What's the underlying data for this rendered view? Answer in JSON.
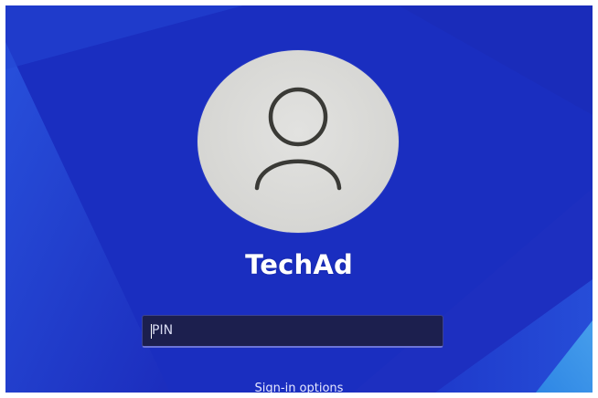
{
  "user": {
    "name": "TechAd",
    "avatar_icon": "person-icon"
  },
  "pin": {
    "placeholder": "PIN",
    "value": ""
  },
  "signin_options": {
    "label": "Sign-in options"
  },
  "colors": {
    "background": "#1a2fc0",
    "avatar": "#d6d6d3",
    "avatar_glyph": "#3a3a36",
    "input_bg": "#1c1f4e",
    "input_accent": "#6b74d8",
    "text": "#ffffff"
  }
}
